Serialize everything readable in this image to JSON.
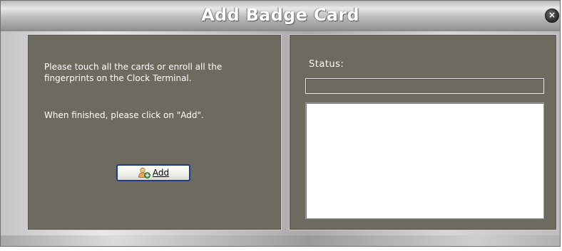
{
  "window": {
    "title": "Add Badge Card",
    "close_symbol": "×"
  },
  "left_panel": {
    "instruction_1": "Please touch all the cards or enroll all the fingerprints on the Clock Terminal.",
    "instruction_2": "When finished, please click on \"Add\".",
    "add_button": {
      "label": "Add",
      "icon": "add-user-icon"
    }
  },
  "right_panel": {
    "status_label": "Status:",
    "progress": 0,
    "status_log": ""
  },
  "colors": {
    "panel_bg": "#6d6a60",
    "title_text": "#ffffff",
    "button_border": "#1f3d8b"
  }
}
